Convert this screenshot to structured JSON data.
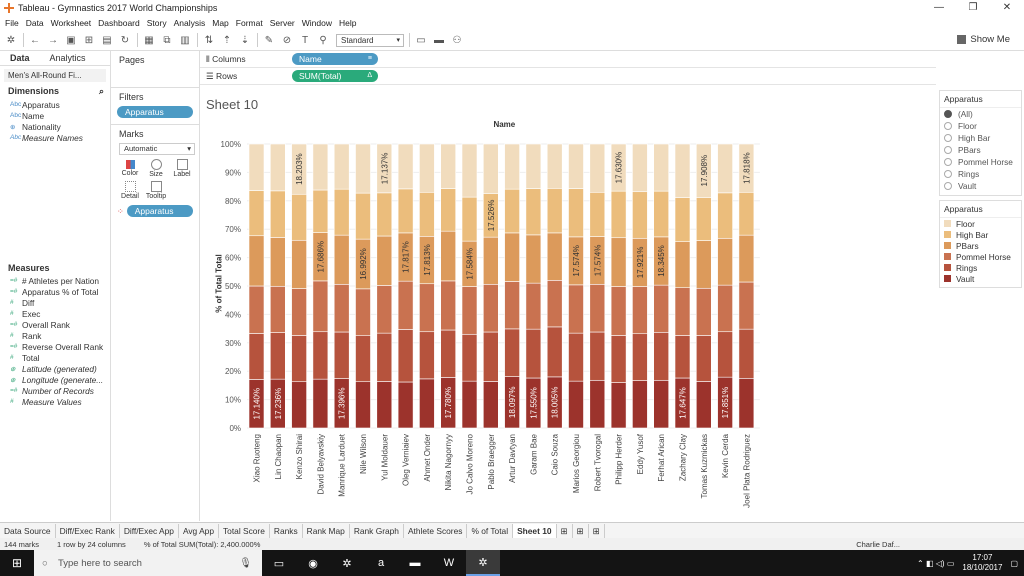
{
  "window": {
    "title": "Tableau - Gymnastics 2017 World Championships",
    "controls": [
      "—",
      "❐",
      "✕"
    ]
  },
  "menu": [
    "File",
    "Data",
    "Worksheet",
    "Dashboard",
    "Story",
    "Analysis",
    "Map",
    "Format",
    "Server",
    "Window",
    "Help"
  ],
  "toolbar": {
    "fit_select": "Standard",
    "show_me": "Show Me"
  },
  "data_pane": {
    "tab_data": "Data",
    "tab_analytics": "Analytics",
    "datasource": "Men's All-Round Fi...",
    "dimensions_label": "Dimensions",
    "dimensions": [
      {
        "name": "Apparatus",
        "type": "Abc",
        "italic": false
      },
      {
        "name": "Name",
        "type": "Abc",
        "italic": false
      },
      {
        "name": "Nationality",
        "type": "⊕",
        "italic": false
      },
      {
        "name": "Measure Names",
        "type": "Abc",
        "italic": true
      }
    ],
    "measures_label": "Measures",
    "measures": [
      {
        "name": "# Athletes per Nation",
        "type": "=#",
        "italic": false
      },
      {
        "name": "Apparatus % of Total",
        "type": "=#",
        "italic": false
      },
      {
        "name": "Diff",
        "type": "#",
        "italic": false
      },
      {
        "name": "Exec",
        "type": "#",
        "italic": false
      },
      {
        "name": "Overall Rank",
        "type": "=#",
        "italic": false
      },
      {
        "name": "Rank",
        "type": "#",
        "italic": false
      },
      {
        "name": "Reverse Overall Rank",
        "type": "=#",
        "italic": false
      },
      {
        "name": "Total",
        "type": "#",
        "italic": false
      },
      {
        "name": "Latitude (generated)",
        "type": "⊕",
        "italic": true
      },
      {
        "name": "Longitude (generate...",
        "type": "⊕",
        "italic": true
      },
      {
        "name": "Number of Records",
        "type": "=#",
        "italic": true
      },
      {
        "name": "Measure Values",
        "type": "#",
        "italic": true
      }
    ]
  },
  "cards": {
    "pages": "Pages",
    "filters": "Filters",
    "filter_pill": "Apparatus",
    "marks": "Marks",
    "mark_type": "Automatic",
    "mark_buttons": [
      "Color",
      "Size",
      "Label",
      "Detail",
      "Tooltip"
    ],
    "marks_pill": "Apparatus"
  },
  "shelves": {
    "columns_label": "Columns",
    "columns_pill": "Name",
    "rows_label": "Rows",
    "rows_pill": "SUM(Total)",
    "rows_pill_icon": "Δ"
  },
  "sheet": {
    "title": "Sheet 10"
  },
  "colors": {
    "Floor": "#f1dcbd",
    "High Bar": "#ebbd7c",
    "PBars": "#dc9a5b",
    "Pommel Horse": "#c97250",
    "Rings": "#b6533d",
    "Vault": "#9c332c"
  },
  "chart_data": {
    "type": "bar",
    "stacked": "percent",
    "xlabel": "Name",
    "ylabel": "% of Total Total",
    "y_ticks": [
      "0%",
      "10%",
      "20%",
      "30%",
      "40%",
      "50%",
      "60%",
      "70%",
      "80%",
      "90%",
      "100%"
    ],
    "categories": [
      "Xiao Ruoteng",
      "Lin Chaopan",
      "Kenzo Shirai",
      "David Belyavskiy",
      "Manrique Larduet",
      "Nile Wilson",
      "Yul Moldauer",
      "Oleg Verniaiev",
      "Ahmet Onder",
      "Nikita Nagornyy",
      "Jo Calvo Moreno",
      "Pablo Braegger",
      "Artur Davtyan",
      "Garam Bae",
      "Caio Souza",
      "Marios Georgiou",
      "Robert Tvorogal",
      "Philipp Herder",
      "Eddy Yusof",
      "Ferhat Arican",
      "Zachary Clay",
      "Tomas Kuzmickas",
      "Kevin Cerda",
      "Joel Plata Rodriguez"
    ],
    "series": [
      {
        "name": "Vault",
        "values": [
          0.171,
          0.172,
          0.163,
          0.172,
          0.174,
          0.163,
          0.164,
          0.162,
          0.173,
          0.178,
          0.165,
          0.164,
          0.181,
          0.176,
          0.18,
          0.165,
          0.168,
          0.16,
          0.167,
          0.168,
          0.176,
          0.164,
          0.179,
          0.175
        ]
      },
      {
        "name": "Rings",
        "values": [
          0.162,
          0.164,
          0.163,
          0.167,
          0.164,
          0.162,
          0.17,
          0.185,
          0.166,
          0.167,
          0.165,
          0.174,
          0.168,
          0.172,
          0.176,
          0.169,
          0.17,
          0.166,
          0.165,
          0.169,
          0.15,
          0.162,
          0.16,
          0.173
        ]
      },
      {
        "name": "Pommel Horse",
        "values": [
          0.167,
          0.163,
          0.165,
          0.179,
          0.168,
          0.165,
          0.168,
          0.17,
          0.169,
          0.173,
          0.168,
          0.168,
          0.167,
          0.162,
          0.164,
          0.17,
          0.168,
          0.172,
          0.166,
          0.166,
          0.168,
          0.166,
          0.164,
          0.166
        ]
      },
      {
        "name": "PBars",
        "values": [
          0.177,
          0.172,
          0.17,
          0.17,
          0.173,
          0.175,
          0.174,
          0.17,
          0.167,
          0.175,
          0.16,
          0.166,
          0.171,
          0.17,
          0.167,
          0.169,
          0.168,
          0.172,
          0.17,
          0.17,
          0.162,
          0.168,
          0.165,
          0.165
        ]
      },
      {
        "name": "High Bar",
        "values": [
          0.159,
          0.164,
          0.162,
          0.15,
          0.162,
          0.162,
          0.152,
          0.155,
          0.155,
          0.15,
          0.155,
          0.153,
          0.154,
          0.163,
          0.157,
          0.17,
          0.156,
          0.164,
          0.164,
          0.161,
          0.155,
          0.152,
          0.16,
          0.151
        ]
      },
      {
        "name": "Floor",
        "values": [
          0.164,
          0.165,
          0.177,
          0.162,
          0.159,
          0.173,
          0.172,
          0.158,
          0.17,
          0.157,
          0.187,
          0.175,
          0.159,
          0.157,
          0.156,
          0.157,
          0.17,
          0.166,
          0.168,
          0.166,
          0.189,
          0.188,
          0.172,
          0.17
        ]
      }
    ],
    "labels": [
      {
        "index": 0,
        "series": "Vault",
        "text": "17.140%"
      },
      {
        "index": 1,
        "series": "Vault",
        "text": "17.236%"
      },
      {
        "index": 2,
        "series": "Floor",
        "text": "18.203%"
      },
      {
        "index": 3,
        "series": "PBars",
        "text": "17.686%"
      },
      {
        "index": 4,
        "series": "Vault",
        "text": "17.396%"
      },
      {
        "index": 5,
        "series": "PBars",
        "text": "16.992%"
      },
      {
        "index": 6,
        "series": "Floor",
        "text": "17.137%"
      },
      {
        "index": 7,
        "series": "PBars",
        "text": "17.817%"
      },
      {
        "index": 8,
        "series": "PBars",
        "text": "17.813%"
      },
      {
        "index": 9,
        "series": "Vault",
        "text": "17.780%"
      },
      {
        "index": 10,
        "series": "PBars",
        "text": "17.584%"
      },
      {
        "index": 11,
        "series": "High Bar",
        "text": "17.526%"
      },
      {
        "index": 12,
        "series": "Vault",
        "text": "18.097%"
      },
      {
        "index": 13,
        "series": "Vault",
        "text": "17.550%"
      },
      {
        "index": 14,
        "series": "Vault",
        "text": "18.005%"
      },
      {
        "index": 15,
        "series": "PBars",
        "text": "17.574%"
      },
      {
        "index": 16,
        "series": "PBars",
        "text": "17.574%"
      },
      {
        "index": 17,
        "series": "Floor",
        "text": "17.630%"
      },
      {
        "index": 18,
        "series": "PBars",
        "text": "17.921%"
      },
      {
        "index": 19,
        "series": "PBars",
        "text": "18.345%"
      },
      {
        "index": 20,
        "series": "Vault",
        "text": "17.647%"
      },
      {
        "index": 21,
        "series": "Floor",
        "text": "17.908%"
      },
      {
        "index": 22,
        "series": "Vault",
        "text": "17.851%"
      },
      {
        "index": 23,
        "series": "Floor",
        "text": "17.818%"
      }
    ],
    "ylim": [
      0,
      1
    ],
    "grid": true
  },
  "legends": {
    "filter_title": "Apparatus",
    "filter_options": [
      "(All)",
      "Floor",
      "High Bar",
      "PBars",
      "Pommel Horse",
      "Rings",
      "Vault"
    ],
    "filter_selected": "(All)",
    "color_title": "Apparatus",
    "color_items": [
      "Floor",
      "High Bar",
      "PBars",
      "Pommel Horse",
      "Rings",
      "Vault"
    ]
  },
  "sheet_tabs": [
    "Data Source",
    "Diff/Exec Rank",
    "Diff/Exec App",
    "Avg App",
    "Total Score",
    "Ranks",
    "Rank Map",
    "Rank Graph",
    "Athlete Scores",
    "% of Total",
    "Sheet 10"
  ],
  "active_tab": "Sheet 10",
  "status": {
    "marks": "144 marks",
    "dims": "1 row by 24 columns",
    "sum": "% of Total SUM(Total): 2,400.000%",
    "user": "Charlie Daf..."
  },
  "taskbar": {
    "search_placeholder": "Type here to search",
    "time": "17:07",
    "date": "18/10/2017"
  }
}
